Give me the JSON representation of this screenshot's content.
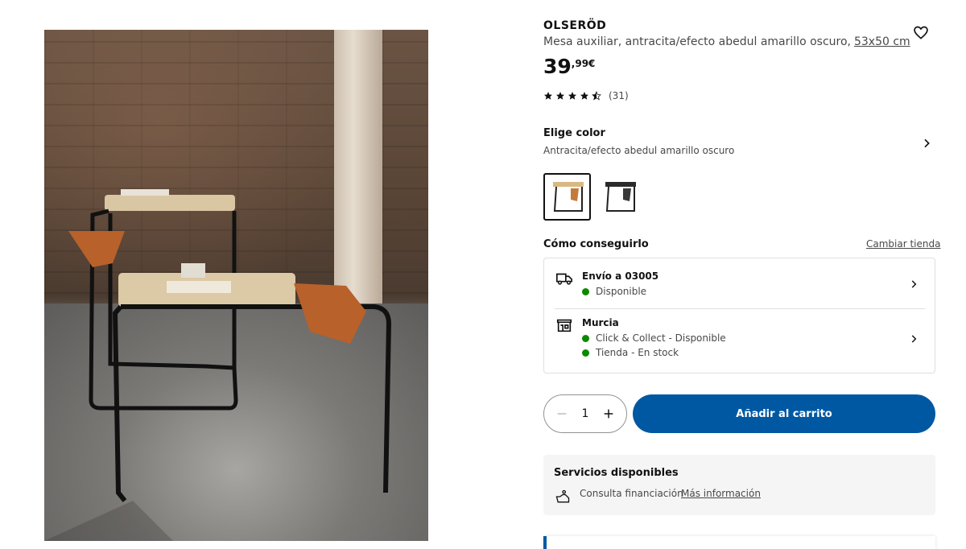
{
  "product": {
    "brand": "OLSERÖD",
    "description": "Mesa auxiliar, antracita/efecto abedul amarillo oscuro,",
    "size_link": "53x50 cm",
    "price_int": "39",
    "price_dec": ",99€",
    "rating": {
      "stars": 4.5,
      "count": "(31)"
    }
  },
  "color": {
    "heading": "Elige color",
    "selected": "Antracita/efecto abedul amarillo oscuro",
    "options": [
      "antracita-abedul",
      "negro"
    ]
  },
  "fulfillment": {
    "heading": "Cómo conseguirlo",
    "change_store": "Cambiar tienda",
    "delivery": {
      "title": "Envío a 03005",
      "status": "Disponible"
    },
    "store": {
      "title": "Murcia",
      "line1": "Click & Collect - Disponible",
      "line2": "Tienda - En stock"
    }
  },
  "cart": {
    "quantity": "1",
    "add_label": "Añadir al carrito"
  },
  "services": {
    "heading": "Servicios disponibles",
    "financing": "Consulta financiación",
    "more_link": "Más información"
  },
  "colors": {
    "primary": "#0058a3",
    "available": "#0a8a00"
  }
}
